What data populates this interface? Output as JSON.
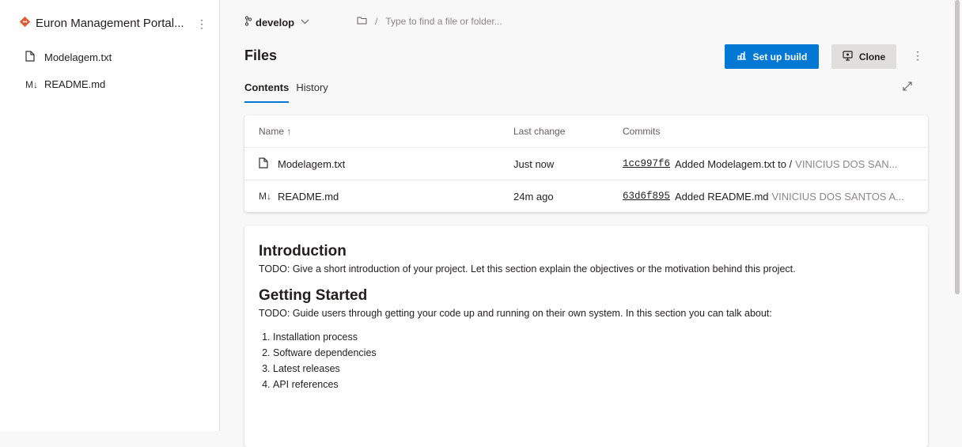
{
  "sidebar": {
    "repo_name": "Euron Management Portal...",
    "repo_icon": "git-repo-icon",
    "more_glyph": "⋮",
    "items": [
      {
        "label": "Modelagem.txt",
        "icon": "file-icon"
      },
      {
        "label": "README.md",
        "icon": "markdown-icon"
      }
    ]
  },
  "topbar": {
    "branch": "develop",
    "path_placeholder": "Type to find a file or folder...",
    "path_separator": "/"
  },
  "page": {
    "title": "Files",
    "setup_build_label": "Set up build",
    "clone_label": "Clone",
    "tabs": [
      {
        "label": "Contents",
        "active": true
      },
      {
        "label": "History",
        "active": false
      }
    ]
  },
  "files_table": {
    "headers": {
      "name": "Name ↑",
      "last_change": "Last change",
      "commits": "Commits"
    },
    "rows": [
      {
        "name": "Modelagem.txt",
        "icon": "file-icon",
        "last_change": "Just now",
        "commit_hash": "1cc997f6",
        "commit_message": "Added Modelagem.txt to /",
        "commit_author": "VINICIUS DOS SAN..."
      },
      {
        "name": "README.md",
        "icon": "markdown-icon",
        "last_change": "24m ago",
        "commit_hash": "63d6f895",
        "commit_message": "Added README.md",
        "commit_author": "VINICIUS DOS SANTOS A..."
      }
    ]
  },
  "readme": {
    "intro_heading": "Introduction",
    "intro_text": "TODO: Give a short introduction of your project. Let this section explain the objectives or the motivation behind this project.",
    "started_heading": "Getting Started",
    "started_text": "TODO: Guide users through getting your code up and running on their own system. In this section you can talk about:",
    "steps": [
      "Installation process",
      "Software dependencies",
      "Latest releases",
      "API references"
    ]
  },
  "colors": {
    "accent": "#0078d4",
    "repo_icon": "#e05a33",
    "author_muted": "#8a8886"
  }
}
